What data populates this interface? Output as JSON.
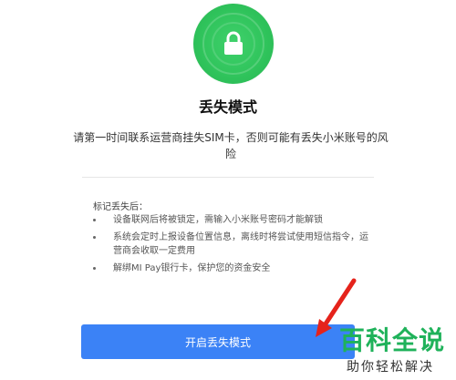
{
  "icon": {
    "name": "lock-icon",
    "color": "#2fc35b"
  },
  "title": "丢失模式",
  "description": "请第一时间联系运营商挂失SIM卡，否则可能有丢失小米账号的风险",
  "after_lost": {
    "heading": "标记丢失后：",
    "items": [
      "设备联网后将被锁定，需输入小米账号密码才能解锁",
      "系统会定时上报设备位置信息，离线时将尝试使用短信指令，运营商会收取一定费用",
      "解绑MI Pay银行卡，保护您的资金安全"
    ]
  },
  "button": {
    "label": "开启丢失模式",
    "color": "#3b82f6"
  },
  "watermark": {
    "big": "百科全说",
    "small": "助你轻松解决",
    "color": "#1fb25a"
  },
  "annotation_arrow": {
    "color": "#e5231b"
  }
}
